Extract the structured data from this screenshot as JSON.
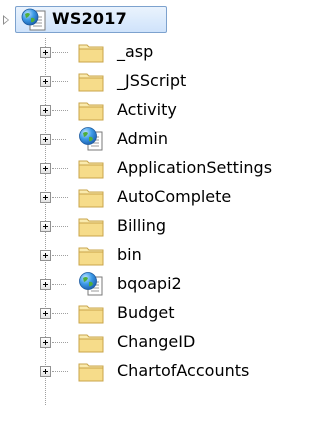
{
  "tree": {
    "root": {
      "label": "WS2017",
      "icon": "web-project-globe-icon",
      "selected": true
    },
    "children": [
      {
        "label": "_asp",
        "icon": "folder-icon"
      },
      {
        "label": "_JSScript",
        "icon": "folder-icon"
      },
      {
        "label": "Activity",
        "icon": "folder-icon"
      },
      {
        "label": "Admin",
        "icon": "web-application-icon"
      },
      {
        "label": "ApplicationSettings",
        "icon": "folder-icon"
      },
      {
        "label": "AutoComplete",
        "icon": "folder-icon"
      },
      {
        "label": "Billing",
        "icon": "folder-icon"
      },
      {
        "label": "bin",
        "icon": "folder-icon"
      },
      {
        "label": "bqoapi2",
        "icon": "web-application-icon"
      },
      {
        "label": "Budget",
        "icon": "folder-icon"
      },
      {
        "label": "ChangeID",
        "icon": "folder-icon"
      },
      {
        "label": "ChartofAccounts",
        "icon": "folder-icon"
      }
    ]
  },
  "colors": {
    "selection_border": "#7da2ce",
    "selection_fill": "#cfe3fb",
    "folder_yellow": "#f5d97e",
    "globe_blue": "#2f7fd0"
  }
}
